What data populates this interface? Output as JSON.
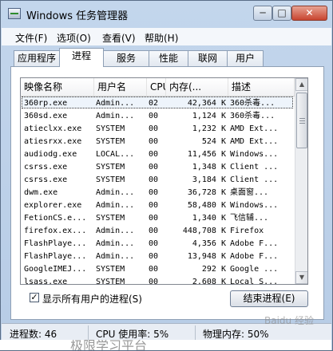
{
  "window": {
    "title": "Windows 任务管理器",
    "min_label": "─",
    "max_label": "□",
    "close_label": "✕"
  },
  "menu": [
    "文件(F)",
    "选项(O)",
    "查看(V)",
    "帮助(H)"
  ],
  "tabs": [
    "应用程序",
    "进程",
    "服务",
    "性能",
    "联网",
    "用户"
  ],
  "active_tab": "进程",
  "columns": [
    "映像名称",
    "用户名",
    "CPU",
    "内存(...",
    "描述"
  ],
  "processes": [
    {
      "name": "360rp.exe",
      "user": "Admin...",
      "cpu": "02",
      "mem": "42,364 K",
      "desc": "360杀毒..."
    },
    {
      "name": "360sd.exe",
      "user": "Admin...",
      "cpu": "00",
      "mem": "1,124 K",
      "desc": "360杀毒..."
    },
    {
      "name": "atieclxx.exe",
      "user": "SYSTEM",
      "cpu": "00",
      "mem": "1,232 K",
      "desc": "AMD Ext..."
    },
    {
      "name": "atiesrxx.exe",
      "user": "SYSTEM",
      "cpu": "00",
      "mem": "524 K",
      "desc": "AMD Ext..."
    },
    {
      "name": "audiodg.exe",
      "user": "LOCAL...",
      "cpu": "00",
      "mem": "11,456 K",
      "desc": "Windows..."
    },
    {
      "name": "csrss.exe",
      "user": "SYSTEM",
      "cpu": "00",
      "mem": "1,348 K",
      "desc": "Client ..."
    },
    {
      "name": "csrss.exe",
      "user": "SYSTEM",
      "cpu": "00",
      "mem": "3,184 K",
      "desc": "Client ..."
    },
    {
      "name": "dwm.exe",
      "user": "Admin...",
      "cpu": "00",
      "mem": "36,728 K",
      "desc": "桌面窗..."
    },
    {
      "name": "explorer.exe",
      "user": "Admin...",
      "cpu": "00",
      "mem": "58,480 K",
      "desc": "Windows..."
    },
    {
      "name": "FetionCS.e...",
      "user": "SYSTEM",
      "cpu": "00",
      "mem": "1,340 K",
      "desc": "飞信辅..."
    },
    {
      "name": "firefox.ex...",
      "user": "Admin...",
      "cpu": "00",
      "mem": "448,708 K",
      "desc": "Firefox"
    },
    {
      "name": "FlashPlaye...",
      "user": "Admin...",
      "cpu": "00",
      "mem": "4,356 K",
      "desc": "Adobe F..."
    },
    {
      "name": "FlashPlaye...",
      "user": "Admin...",
      "cpu": "00",
      "mem": "13,948 K",
      "desc": "Adobe F..."
    },
    {
      "name": "GoogleIMEJ...",
      "user": "SYSTEM",
      "cpu": "00",
      "mem": "292 K",
      "desc": "Google ..."
    },
    {
      "name": "lsass.exe",
      "user": "SYSTEM",
      "cpu": "00",
      "mem": "2,608 K",
      "desc": "Local S..."
    }
  ],
  "selected_index": 0,
  "show_all_users": {
    "checked": true,
    "label": "显示所有用户的进程(S)",
    "mark": "✓"
  },
  "end_process_label": "结束进程(E)",
  "status": {
    "processes": "进程数: 46",
    "cpu": "CPU 使用率: 5%",
    "memory": "物理内存: 50%"
  },
  "watermark": "Baidu 经验",
  "bottom_fragment": "极限学习平台"
}
